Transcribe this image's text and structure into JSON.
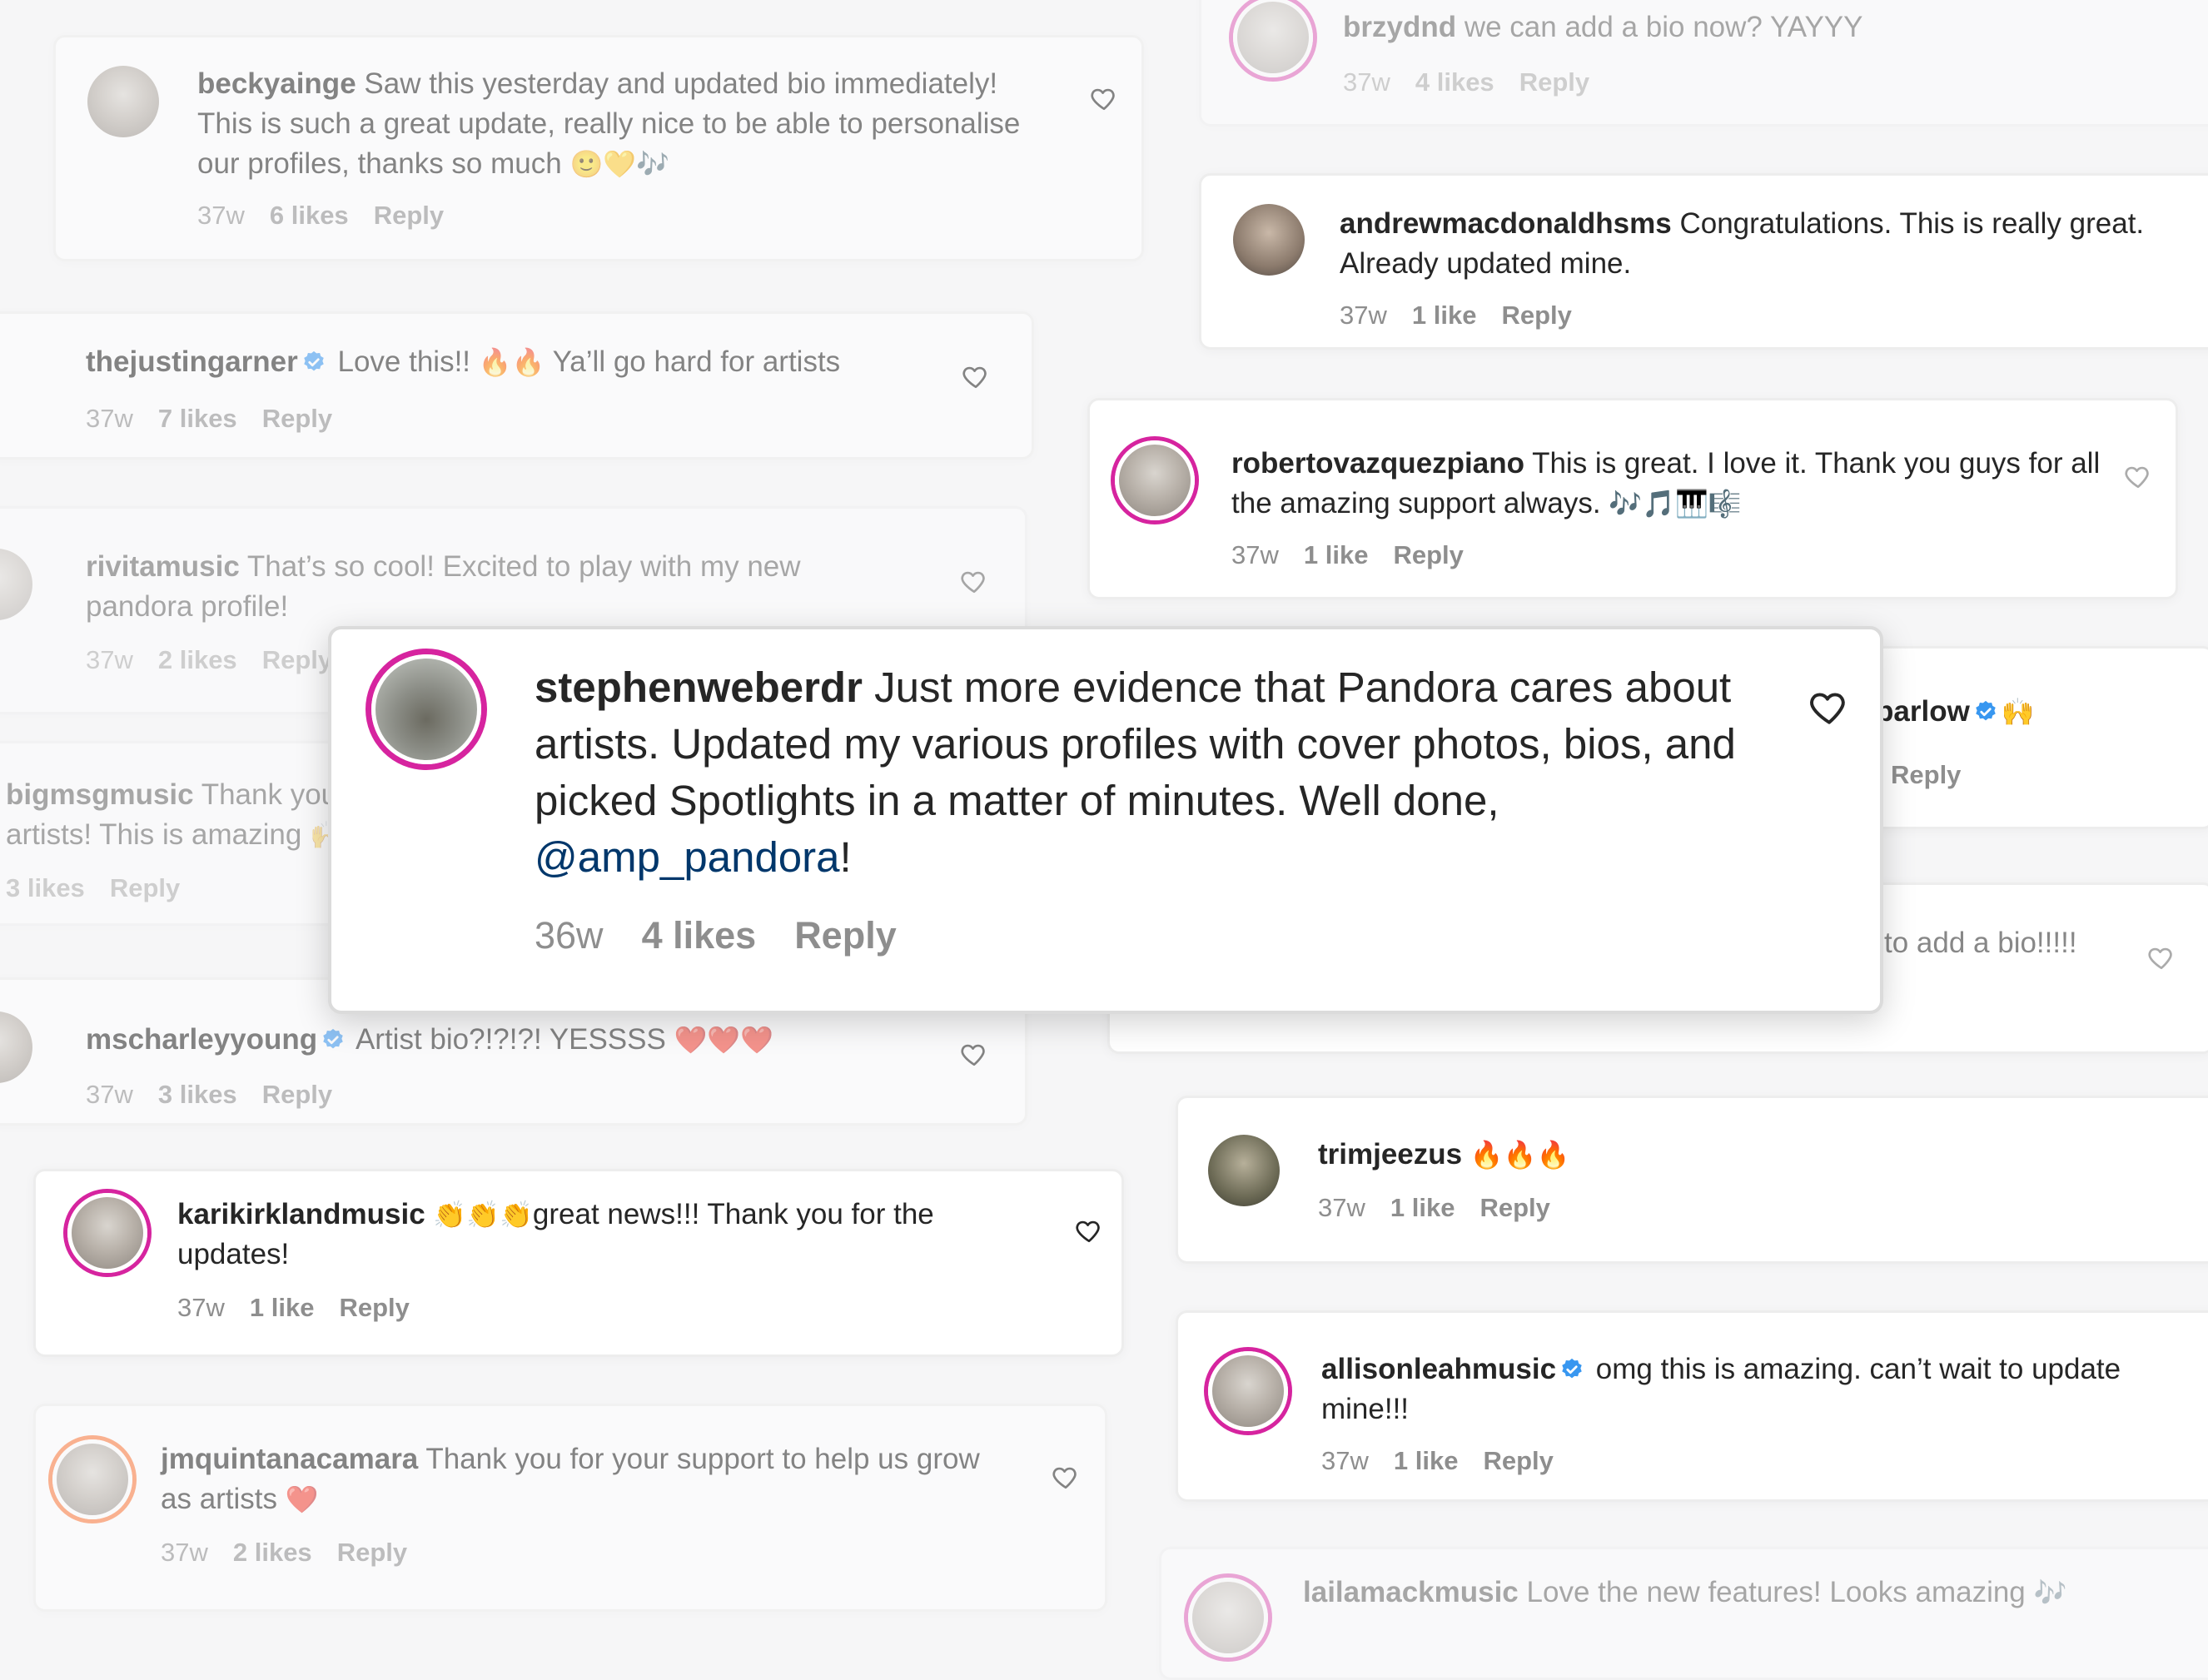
{
  "featured": {
    "username": "stephenweberdr",
    "text_before": "Just more evidence that Pandora cares about artists. Updated my various profiles with cover photos, bios, and picked Spotlights in a matter of minutes. Well done, ",
    "mention": "@amp_pandora",
    "text_after": "!",
    "time": "36w",
    "likes": "4 likes",
    "reply": "Reply"
  },
  "left_comments": [
    {
      "username": "beckyainge",
      "text": "Saw this yesterday and updated bio immediately! This is such a great update, really nice to be able to personalise our profiles, thanks so much",
      "emoji": "🙂💛🎶",
      "time": "37w",
      "likes": "6 likes",
      "reply": "Reply"
    },
    {
      "username": "thejustingarner",
      "text": "Love this!!",
      "emoji": "🔥🔥",
      "text2": "Ya’ll go hard for artists",
      "time": "37w",
      "likes": "7 likes",
      "reply": "Reply"
    },
    {
      "username": "rivitamusic",
      "text": "That’s so cool! Excited to play with my new pandora profile!",
      "time": "37w",
      "likes": "2 likes",
      "reply": "Reply"
    },
    {
      "username": "bigmsgmusic",
      "text": "Thank you",
      "text_line2": "artists! This is amazing",
      "emoji": "🙌",
      "likes": "3 likes",
      "reply": "Reply"
    },
    {
      "username": "mscharleyyoung",
      "text": "Artist bio?!?!?! YESSSS",
      "emoji": "❤️❤️❤️",
      "time": "37w",
      "likes": "3 likes",
      "reply": "Reply"
    },
    {
      "username": "karikirklandmusic",
      "emoji": "👏👏👏",
      "text": "great news!!! Thank you for the updates!",
      "time": "37w",
      "likes": "1 like",
      "reply": "Reply"
    },
    {
      "username": "jmquintanacamara",
      "text": "Thank you for your support to help us grow as artists",
      "emoji": "❤️",
      "time": "37w",
      "likes": "2 likes",
      "reply": "Reply"
    }
  ],
  "right_comments": [
    {
      "username": "brzydnd",
      "text": "we can add a bio now? YAYYY",
      "time": "37w",
      "likes": "4 likes",
      "reply": "Reply"
    },
    {
      "username": "andrewmacdonaldhsms",
      "text": "Congratulations. This is really great. Already updated mine.",
      "time": "37w",
      "likes": "1 like",
      "reply": "Reply"
    },
    {
      "username": "robertovazquezpiano",
      "text": "This is great. I love it. Thank you guys for all the amazing support always.",
      "emoji": "🎶🎵🎹🎼",
      "time": "37w",
      "likes": "1 like",
      "reply": "Reply"
    },
    {
      "username_partial": "barlow",
      "emoji": "🙌",
      "reply": "Reply"
    },
    {
      "text_partial": "to add a bio!!!!!"
    },
    {
      "username": "trimjeezus",
      "emoji": "🔥🔥🔥",
      "time": "37w",
      "likes": "1 like",
      "reply": "Reply"
    },
    {
      "username": "allisonleahmusic",
      "text": "omg this is amazing. can’t wait to update mine!!!",
      "time": "37w",
      "likes": "1 like",
      "reply": "Reply"
    },
    {
      "username": "lailamackmusic",
      "text": "Love the new features! Looks amazing",
      "emoji": "🎶"
    }
  ]
}
